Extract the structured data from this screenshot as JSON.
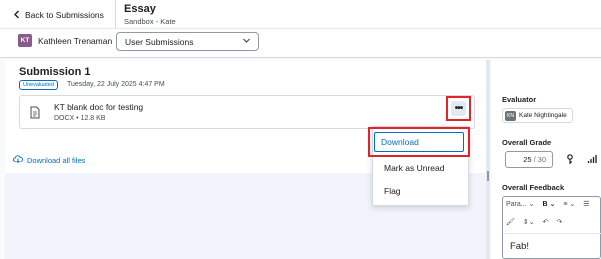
{
  "header": {
    "back_label": "Back to Submissions",
    "title": "Essay",
    "subtitle": "Sandbox - Kate",
    "user_initials": "KT",
    "user_name": "Kathleen Trenaman",
    "view_select": "User Submissions"
  },
  "submission": {
    "heading": "Submission 1",
    "status": "Unevaluated",
    "date": "Tuesday, 22 July 2025 4:47 PM",
    "file_name": "KT blank doc for testing",
    "file_meta": "DOCX • 12.8 KB",
    "more_label": "•••",
    "download_all": "Download all files"
  },
  "context_menu": {
    "items": [
      "Download",
      "Mark as Unread",
      "Flag"
    ]
  },
  "evaluation": {
    "evaluator_label": "Evaluator",
    "evaluator_initials": "KN",
    "evaluator_name": "Kate Nightingale",
    "grade_label": "Overall Grade",
    "grade_value": "25",
    "grade_sep": "/",
    "grade_out_of": "30",
    "feedback_label": "Overall Feedback",
    "toolbar": {
      "paragraph": "Para...",
      "bold": "B",
      "align": "≡"
    },
    "feedback_text": "Fab!"
  },
  "colors": {
    "highlight": "#e2242a",
    "link": "#006fbf",
    "user_badge": "#8a5a8f",
    "evaluator_badge": "#6e7376"
  }
}
